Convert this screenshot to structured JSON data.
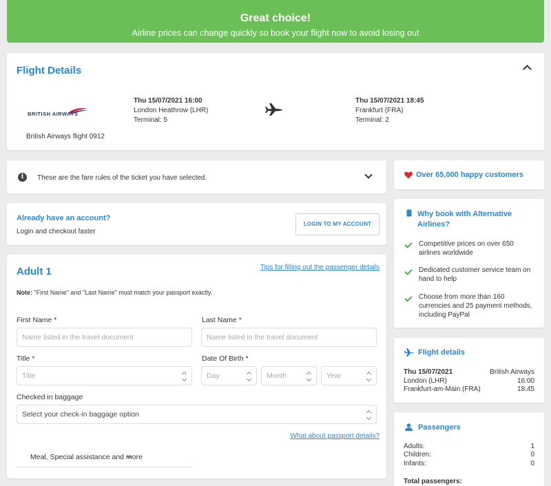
{
  "banner": {
    "title": "Great choice!",
    "subtitle": "Airline prices can change quickly so book your flight now to avoid losing out",
    "color": "#6abf57"
  },
  "flight_details": {
    "title": "Flight Details",
    "airline_logo_text": "BRITISH AIRWAYS",
    "flight_label": "British Airways flight 0912",
    "departure": {
      "datetime": "Thu 15/07/2021 16:00",
      "airport": "London Heathrow (LHR)",
      "terminal": "Terminal: 5"
    },
    "arrival": {
      "datetime": "Thu 15/07/2021 18:45",
      "airport": "Frankfurt (FRA)",
      "terminal": "Terminal: 2"
    }
  },
  "fare_rules": {
    "text": "These are the fare rules of the ticket you have selected."
  },
  "account": {
    "title": "Already have an account?",
    "subtitle": "Login and checkout faster",
    "login_button": "LOGIN TO MY ACCOUNT"
  },
  "passenger_form": {
    "title": "Adult 1",
    "tips_link": "Tips for filling out the passenger details",
    "note_label": "Note:",
    "note_text": " \"First Name\" and \"Last Name\" must match your passport exactly.",
    "first_name_label": "First Name *",
    "first_name_placeholder": "Name listed in the travel document",
    "last_name_label": "Last Name *",
    "last_name_placeholder": "Name listed in the travel document",
    "title_label": "Title *",
    "title_value": "Title",
    "dob_label": "Date Of Birth *",
    "dob_day": "Day",
    "dob_month": "Month",
    "dob_year": "Year",
    "baggage_label": "Checked in baggage",
    "baggage_value": "Select your check-in baggage option",
    "passport_link": "What about passport details?",
    "meal_link": "Meal, Special assistance and more"
  },
  "sidebar": {
    "happy_customers": "Over 65,000 happy customers",
    "heart_color": "#d32f2f",
    "why_title": "Why book with Alternative Airlines?",
    "why_items": [
      "Competitive prices on over 650 airlines worldwide",
      "Dedicated customer service team on hand to help",
      "Choose from more than 160 currencies and 25 payment methods, including PayPal"
    ],
    "flight_details": {
      "title": "Flight details",
      "date": "Thu 15/07/2021",
      "airline": "British Airways",
      "origin": "London (LHR)",
      "origin_time": "16:00",
      "destination": "Frankfurt-am-Main (FRA)",
      "destination_time": "18:45"
    },
    "passengers": {
      "title": "Passengers",
      "adults_label": "Adults:",
      "adults": "1",
      "children_label": "Children:",
      "children": "0",
      "infants_label": "Infants:",
      "infants": "0",
      "total_label": "Total passengers:"
    }
  },
  "accent_color": "#2b86d1"
}
